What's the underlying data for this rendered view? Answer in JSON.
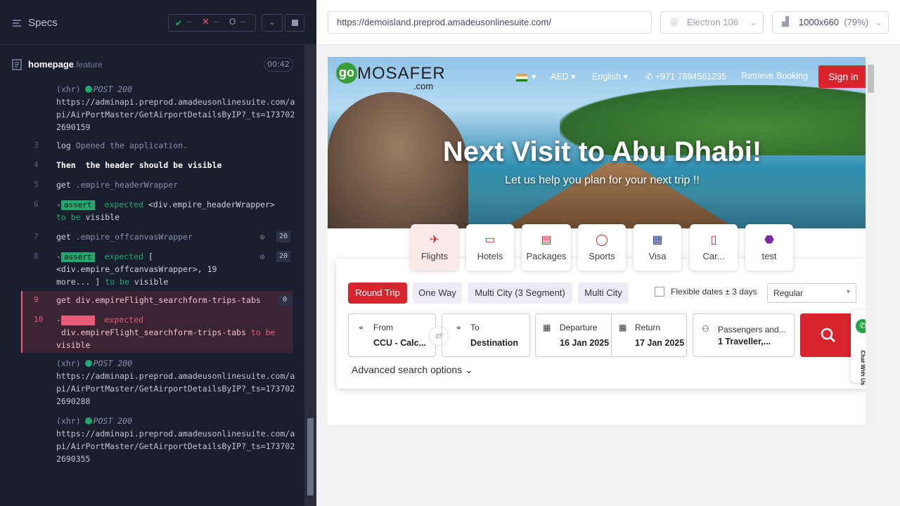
{
  "specs": {
    "title": "Specs",
    "passed": "--",
    "failed": "--",
    "pending": "--"
  },
  "file": {
    "name": "homepage",
    "ext": ".feature",
    "timer": "00:42"
  },
  "log": {
    "xhr1": {
      "type": "(xhr)",
      "method": "POST 200",
      "url": "https://adminapi.preprod.amadeusonlinesuite.com/api/AirPortMaster/GetAirportDetailsByIP?_ts=1737022690159"
    },
    "steps": [
      {
        "num": "3",
        "cmd": "log",
        "text": "Opened the application."
      },
      {
        "num": "4",
        "cmd": "Then",
        "text": "the header should be visible"
      },
      {
        "num": "5",
        "cmd": "get",
        "text": ".empire_headerWrapper"
      },
      {
        "num": "6",
        "badge": "assert",
        "expected": "expected",
        "subject": "<div.empire_headerWrapper>",
        "tobe": "to be",
        "state": "visible"
      },
      {
        "num": "7",
        "cmd": "get",
        "text": ".empire_offcanvasWrapper",
        "count": "20"
      },
      {
        "num": "8",
        "badge": "assert",
        "expected": "expected",
        "subject": "[",
        "subject2": "<div.empire_offcanvasWrapper>, 19",
        "subject3": "more... ]",
        "tobe": "to be",
        "state": "visible",
        "count": "20"
      },
      {
        "num": "9",
        "cmd": "get",
        "text": "div.empireFlight_searchform-trips-tabs",
        "count": "0"
      },
      {
        "num": "10",
        "badge": "assert",
        "expected": "expected",
        "subject": "div.empireFlight_searchform-trips-tabs",
        "tobe": "to be",
        "state": "visible"
      }
    ],
    "xhr2": {
      "type": "(xhr)",
      "method": "POST 200",
      "url": "https://adminapi.preprod.amadeusonlinesuite.com/api/AirPortMaster/GetAirportDetailsByIP?_ts=1737022690288"
    },
    "xhr3": {
      "type": "(xhr)",
      "method": "POST 200",
      "url": "https://adminapi.preprod.amadeusonlinesuite.com/api/AirPortMaster/GetAirportDetailsByIP?_ts=1737022690355"
    }
  },
  "browser": {
    "url": "https://demoisland.preprod.amadeusonlinesuite.com/",
    "engine": "Electron 106",
    "viewport": "1000x660",
    "zoom": "(79%)"
  },
  "site": {
    "logo_go": "go",
    "logo_main": "MOSAFER",
    "logo_com": ".com",
    "currency": "AED",
    "language": "English",
    "phone": "+971 7894561235",
    "retrieve": "Retrieve Booking",
    "signin": "Sign in",
    "hero_title": "Next Visit to Abu Dhabi!",
    "hero_sub": "Let us help you plan for your next trip !!",
    "tabs": [
      "Flights",
      "Hotels",
      "Packages",
      "Sports",
      "Visa",
      "Car...",
      "test"
    ],
    "trips": [
      "Round Trip",
      "One Way",
      "Multi City (3 Segment)",
      "Multi City"
    ],
    "flex": "Flexible dates ± 3 days",
    "cabin": "Regular",
    "from_label": "From",
    "from_value": "CCU - Calc...",
    "to_label": "To",
    "to_value": "Destination",
    "dep_label": "Departure",
    "dep_value": "16 Jan 2025",
    "ret_label": "Return",
    "ret_value": "17 Jan 2025",
    "pax_label": "Passengers and...",
    "pax_value": "1 Traveller,...",
    "advanced": "Advanced search options",
    "chat": "Chat With Us"
  }
}
